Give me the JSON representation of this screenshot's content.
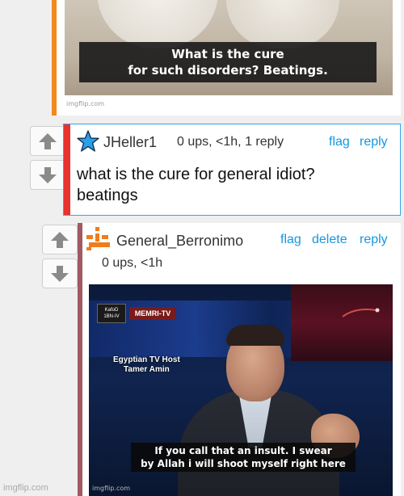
{
  "parent_post": {
    "image": {
      "caption_line1": "What is the cure",
      "caption_line2": "for such disorders? Beatings.",
      "watermark": "imgflip.com"
    }
  },
  "comments": [
    {
      "username": "JHeller1",
      "avatar_icon": "star-icon",
      "meta": "0 ups, <1h, 1 reply",
      "actions": [
        "flag",
        "reply"
      ],
      "body_line1": "what is the cure for general idiot?",
      "body_line2": "beatings"
    },
    {
      "username": "General_Berronimo",
      "avatar_icon": "pixel-logo-icon",
      "meta": "0 ups, <1h",
      "actions": [
        "flag",
        "delete",
        "reply"
      ],
      "image": {
        "logo_line1": "KafoD",
        "logo_line2": "1BN-IV",
        "banner": "MEMRI-TV",
        "host_line1": "Egyptian TV Host",
        "host_line2": "Tamer Amin",
        "caption_line1": "If you call that an insult. I swear",
        "caption_line2": "by Allah i will shoot myself right here",
        "watermark": "imgflip.com"
      }
    }
  ],
  "page_footer": {
    "watermark": "imgflip.com"
  },
  "colors": {
    "parent_accent": "#f28a1c",
    "reply1_accent": "#e83330",
    "reply1_border": "#3aa3ea",
    "reply2_accent": "#a15a62",
    "link": "#1597e0"
  }
}
